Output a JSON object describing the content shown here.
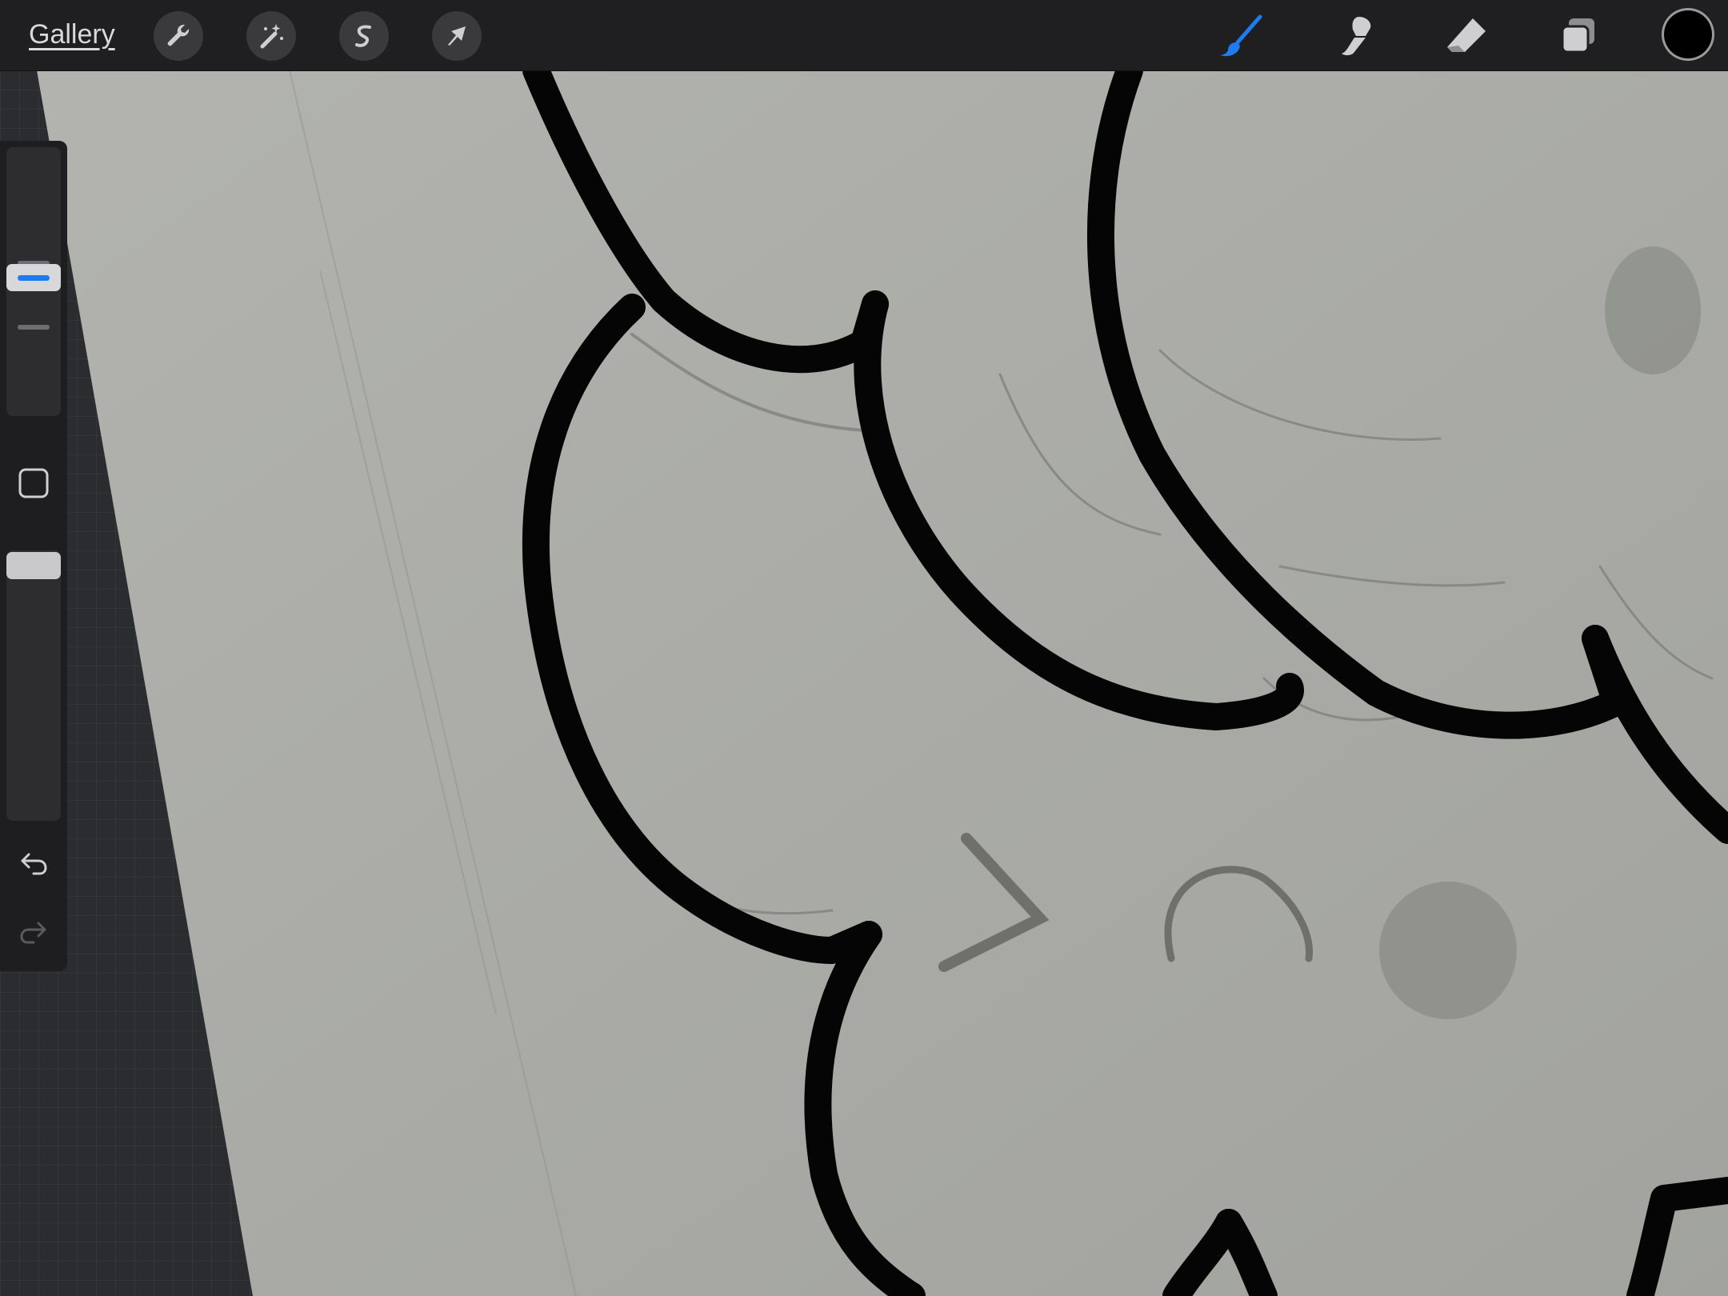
{
  "topbar": {
    "gallery_label": "Gallery",
    "left_tools": [
      "wrench-icon",
      "magic-wand-icon",
      "selection-icon",
      "transform-arrow-icon"
    ],
    "right_tools": [
      "brush-icon",
      "smudge-icon",
      "eraser-icon",
      "layers-icon"
    ],
    "active_tool": "brush",
    "current_color": "#000000",
    "accent_color": "#1e7cf2"
  },
  "sidebar": {
    "brush_size_level": 0.45,
    "opacity_level": 1.0,
    "icons": [
      "modify-square-icon",
      "undo-icon",
      "redo-icon"
    ]
  },
  "canvas": {
    "paper_color": "#a9aaa5",
    "stroke_color": "#050505"
  }
}
